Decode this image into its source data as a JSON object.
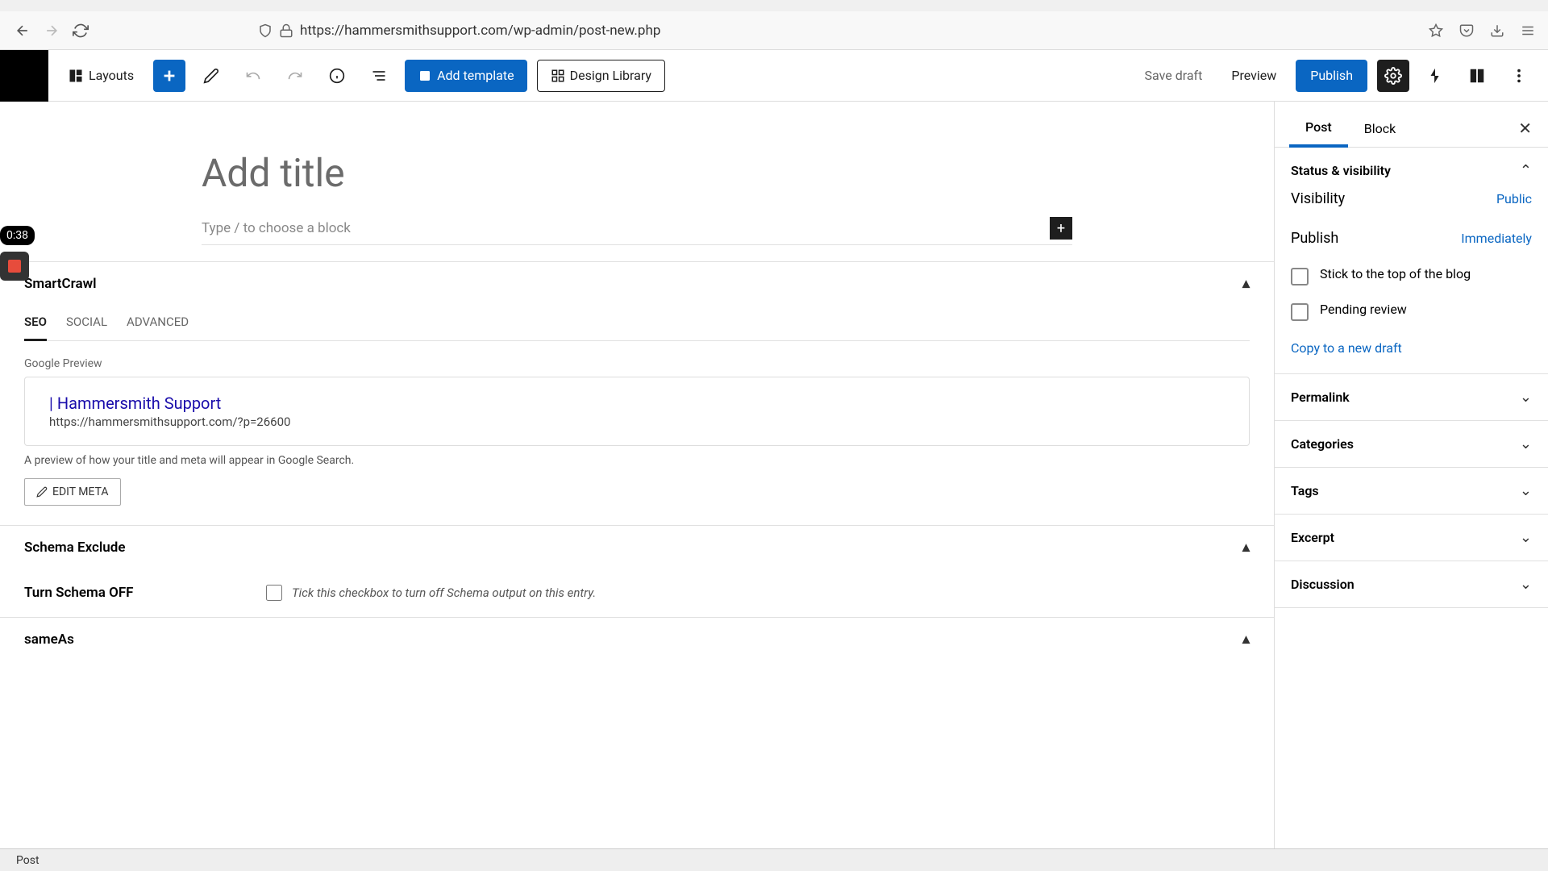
{
  "browser": {
    "url": "https://hammersmithsupport.com/wp-admin/post-new.php"
  },
  "toolbar": {
    "layouts": "Layouts",
    "add_template": "Add template",
    "design_library": "Design Library",
    "save_draft": "Save draft",
    "preview": "Preview",
    "publish": "Publish"
  },
  "recording": {
    "time": "0:38"
  },
  "editor": {
    "title_placeholder": "Add title",
    "block_placeholder": "Type / to choose a block"
  },
  "smartcrawl": {
    "title": "SmartCrawl",
    "tabs": {
      "seo": "SEO",
      "social": "SOCIAL",
      "advanced": "ADVANCED"
    },
    "google_preview_label": "Google Preview",
    "gp_title": "| Hammersmith Support",
    "gp_url": "https://hammersmithsupport.com/?p=26600",
    "gp_help": "A preview of how your title and meta will appear in Google Search.",
    "edit_meta": "EDIT META"
  },
  "schema": {
    "heading": "Schema Exclude",
    "label": "Turn Schema OFF",
    "help": "Tick this checkbox to turn off Schema output on this entry."
  },
  "sameas": {
    "heading": "sameAs"
  },
  "sidebar": {
    "tabs": {
      "post": "Post",
      "block": "Block"
    },
    "status": {
      "heading": "Status & visibility",
      "visibility_label": "Visibility",
      "visibility_value": "Public",
      "publish_label": "Publish",
      "publish_value": "Immediately",
      "stick": "Stick to the top of the blog",
      "pending": "Pending review",
      "copy": "Copy to a new draft"
    },
    "permalink": "Permalink",
    "categories": "Categories",
    "tags": "Tags",
    "excerpt": "Excerpt",
    "discussion": "Discussion"
  },
  "bottom": {
    "post": "Post"
  }
}
